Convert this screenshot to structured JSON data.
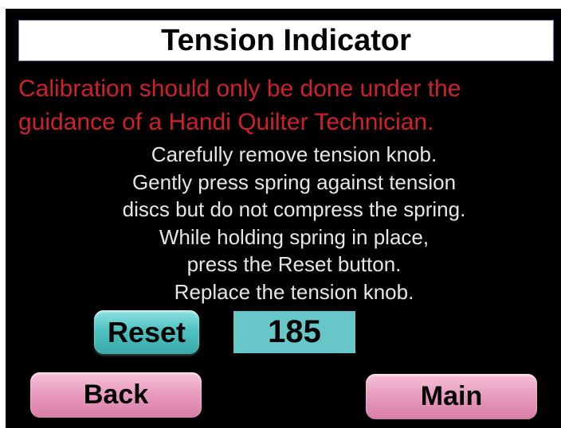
{
  "title": "Tension Indicator",
  "warning": [
    "Calibration should only be done under the",
    "guidance of a Handi Quilter Technician."
  ],
  "instructions": [
    "Carefully remove tension knob.",
    "Gently press spring against tension",
    "discs but do not compress the spring.",
    "While holding spring in place,",
    "press the Reset button.",
    "Replace the tension knob."
  ],
  "reset_label": "Reset",
  "tension_value": "185",
  "back_label": "Back",
  "main_label": "Main",
  "colors": {
    "background": "#000000",
    "warning_text": "#d0202a",
    "reset_button": "#4fc1c1",
    "value_box": "#67c6c7",
    "nav_button": "#e79abd"
  }
}
